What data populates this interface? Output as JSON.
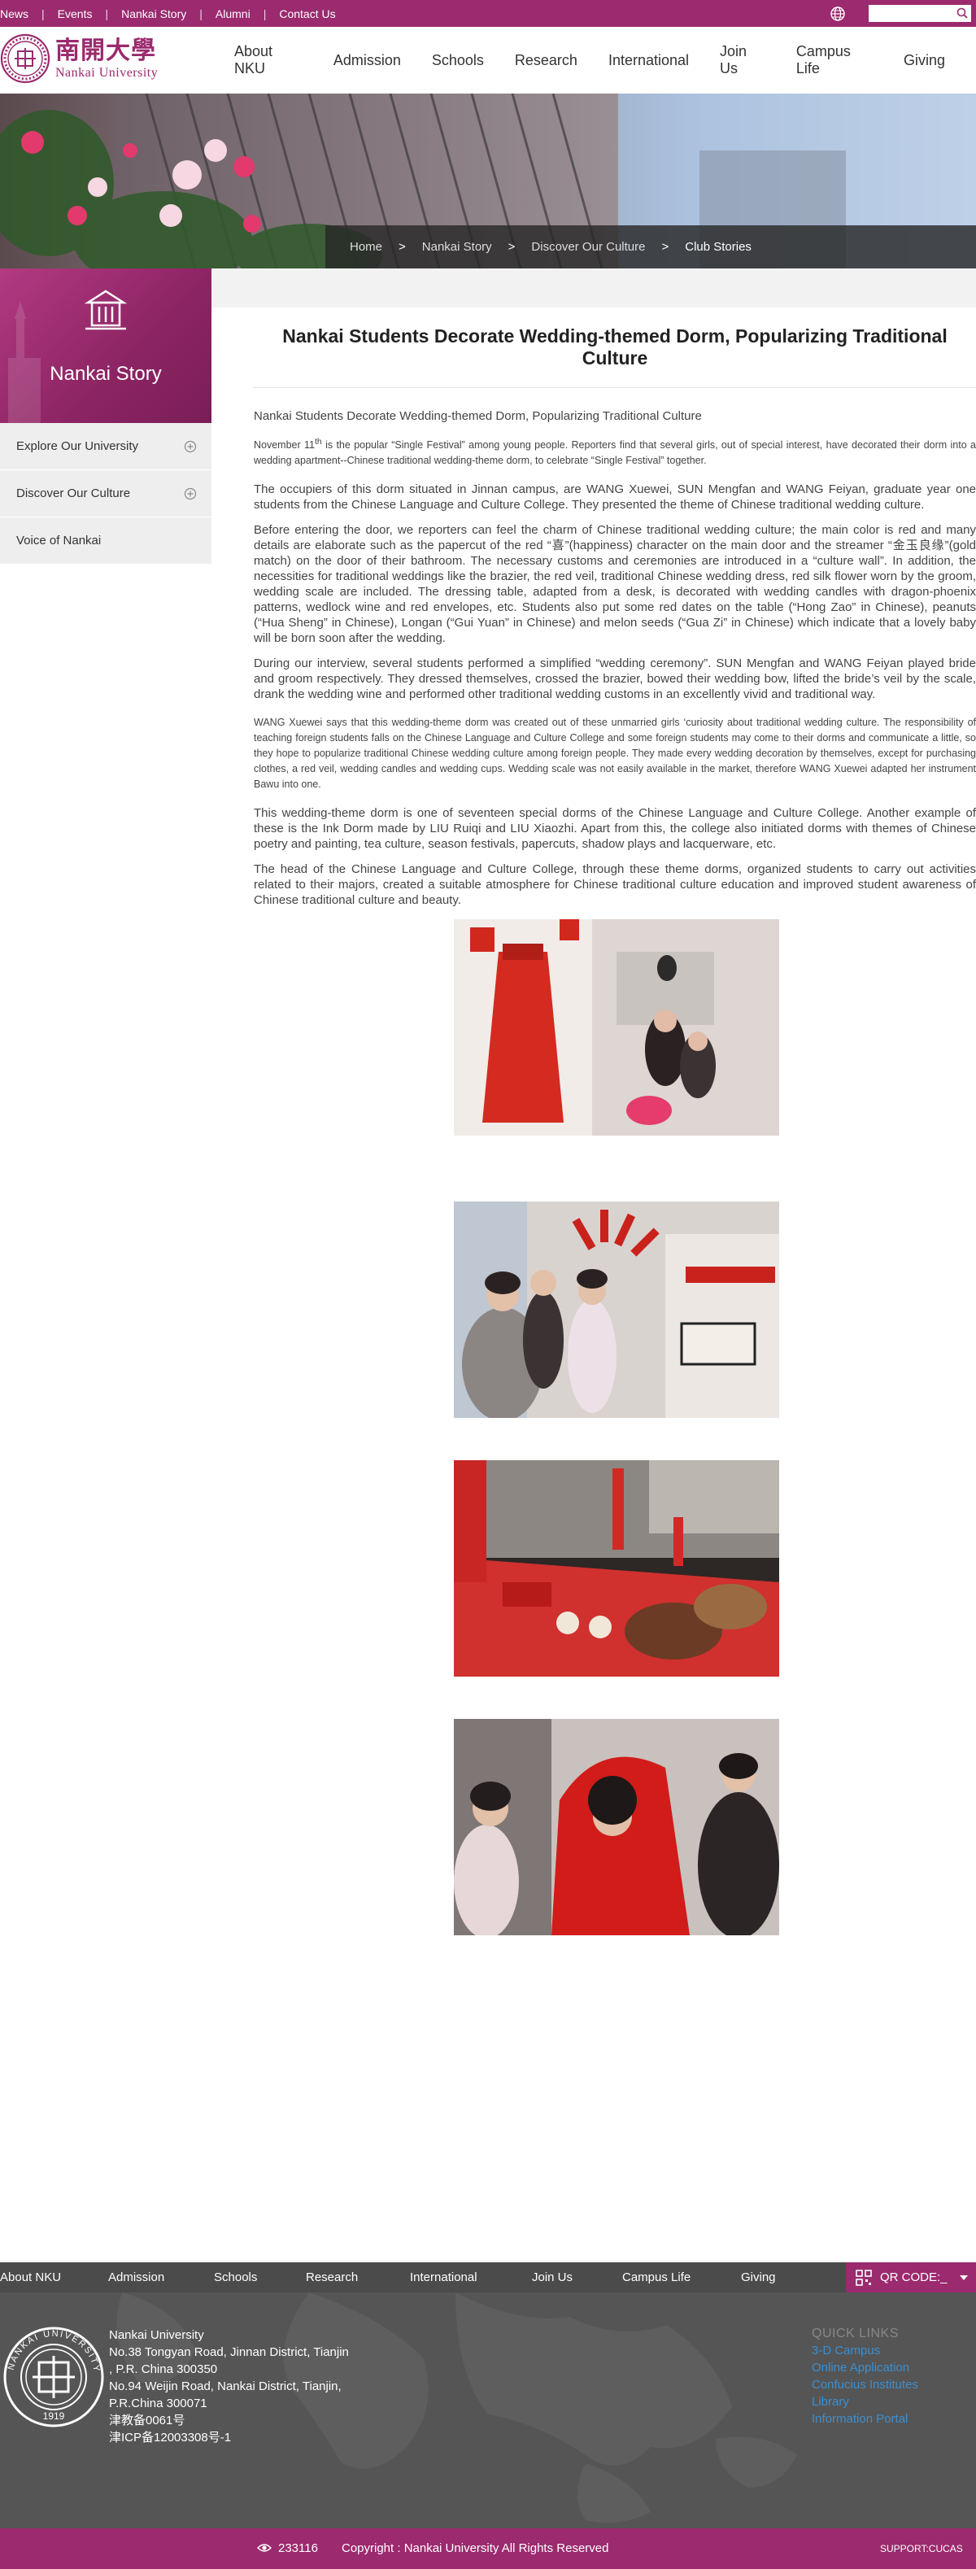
{
  "topbar": {
    "links": [
      "News",
      "Events",
      "Nankai Story",
      "Alumni",
      "Contact Us"
    ],
    "search_placeholder": ""
  },
  "logo": {
    "cn": "南開大學",
    "en": "Nankai University"
  },
  "main_nav": [
    "About NKU",
    "Admission",
    "Schools",
    "Research",
    "International",
    "Join Us",
    "Campus Life",
    "Giving"
  ],
  "breadcrumb": [
    "Home",
    "Nankai Story",
    "Discover Our Culture",
    "Club Stories"
  ],
  "breadcrumb_sep": ">",
  "sidebar": {
    "title": "Nankai Story",
    "items": [
      {
        "label": "Explore Our University",
        "expandable": true
      },
      {
        "label": "Discover Our Culture",
        "expandable": true
      },
      {
        "label": "Voice of Nankai",
        "expandable": false
      }
    ]
  },
  "article": {
    "title": "Nankai Students Decorate Wedding-themed Dorm, Popularizing Traditional Culture",
    "subtitle": "Nankai Students Decorate Wedding-themed Dorm, Popularizing Traditional Culture",
    "p1_a": "November 11",
    "p1_sup": "th",
    "p1_b": " is the popular “Single Festival” among young people. Reporters find that several girls, out of special interest, have decorated their dorm into a wedding apartment--Chinese traditional wedding-theme dorm, to celebrate “Single Festival” together.",
    "paragraphs": [
      "The occupiers of this dorm situated in Jinnan campus, are WANG Xuewei, SUN Mengfan and WANG Feiyan, graduate year one students from the Chinese Language and Culture College. They presented the theme of Chinese traditional wedding culture.",
      "Before entering the door, we reporters can feel the charm of Chinese traditional wedding culture; the main color is red and many details are elaborate such as the papercut of the red “喜”(happiness) character on the main door and the streamer “金玉良缘”(gold match) on the door of their bathroom. The necessary customs and ceremonies are introduced in a “culture wall”. In addition, the necessities for traditional weddings like the brazier, the red veil, traditional Chinese wedding dress, red silk flower worn by the groom, wedding scale are included. The dressing table, adapted from a desk, is decorated with wedding candles with dragon-phoenix patterns, wedlock wine and red envelopes, etc. Students also put some red dates on the table (“Hong Zao” in Chinese), peanuts (“Hua Sheng” in Chinese), Longan (“Gui Yuan” in Chinese) and melon seeds (“Gua Zi” in Chinese) which indicate that a lovely baby will be born soon after the wedding.",
      "During our interview, several students performed a simplified “wedding ceremony”. SUN Mengfan and WANG Feiyan played bride and groom respectively. They dressed themselves, crossed the brazier, bowed their wedding bow, lifted the bride’s veil by the scale, drank the wedding wine and performed other traditional wedding customs in an excellently vivid and traditional way."
    ],
    "small_paragraph": "WANG Xuewei says that this wedding-theme dorm was created out of these unmarried girls ‘curiosity about traditional wedding culture. The responsibility of teaching foreign students falls on the Chinese Language and Culture College and some foreign students may come to their dorms and communicate a little, so they hope to popularize traditional Chinese wedding culture among foreign people. They made every wedding decoration by themselves, except for purchasing clothes, a red veil, wedding candles and wedding cups. Wedding scale was not easily available in the market, therefore WANG Xuewei adapted her instrument Bawu into one.",
    "closing_paragraphs": [
      "This wedding-theme dorm is one of seventeen special dorms of the Chinese Language and Culture College. Another example of these is the Ink Dorm made by LIU Ruiqi and LIU Xiaozhi. Apart from this, the college also initiated dorms with themes of Chinese poetry and painting, tea culture, season festivals, papercuts, shadow plays and lacquerware, etc.",
      "The head of the Chinese Language and Culture College, through these theme dorms, organized students to carry out activities related to their majors, created a suitable atmosphere for Chinese traditional culture education and improved student awareness of Chinese traditional culture and beauty."
    ]
  },
  "footer_nav": [
    "About NKU",
    "Admission",
    "Schools",
    "Research",
    "International",
    "Join Us",
    "Campus Life",
    "Giving"
  ],
  "qr_label": "QR CODE:_",
  "footer": {
    "address_lines": [
      "Nankai University",
      "No.38 Tongyan Road, Jinnan District, Tianjin",
      ", P.R. China 300350",
      "No.94 Weijin Road,  Nankai District, Tianjin,",
      "P.R.China  300071",
      "津教备0061号",
      "津ICP备12003308号-1"
    ],
    "quick_links_title": "QUICK LINKS",
    "quick_links": [
      "3-D Campus",
      "Online Application",
      "Confucius Institutes",
      "Library",
      "Information Portal"
    ],
    "seal_year": "1919",
    "seal_text": "NANKAI UNIVERSITY"
  },
  "bottom": {
    "visits": "233116",
    "copyright": "Copyright : Nankai University All Rights Reserved",
    "support": "SUPPORT:CUCAS"
  },
  "colors": {
    "brand": "#9b2a6e",
    "footer_bg": "#555555",
    "link": "#3b8fd1"
  }
}
